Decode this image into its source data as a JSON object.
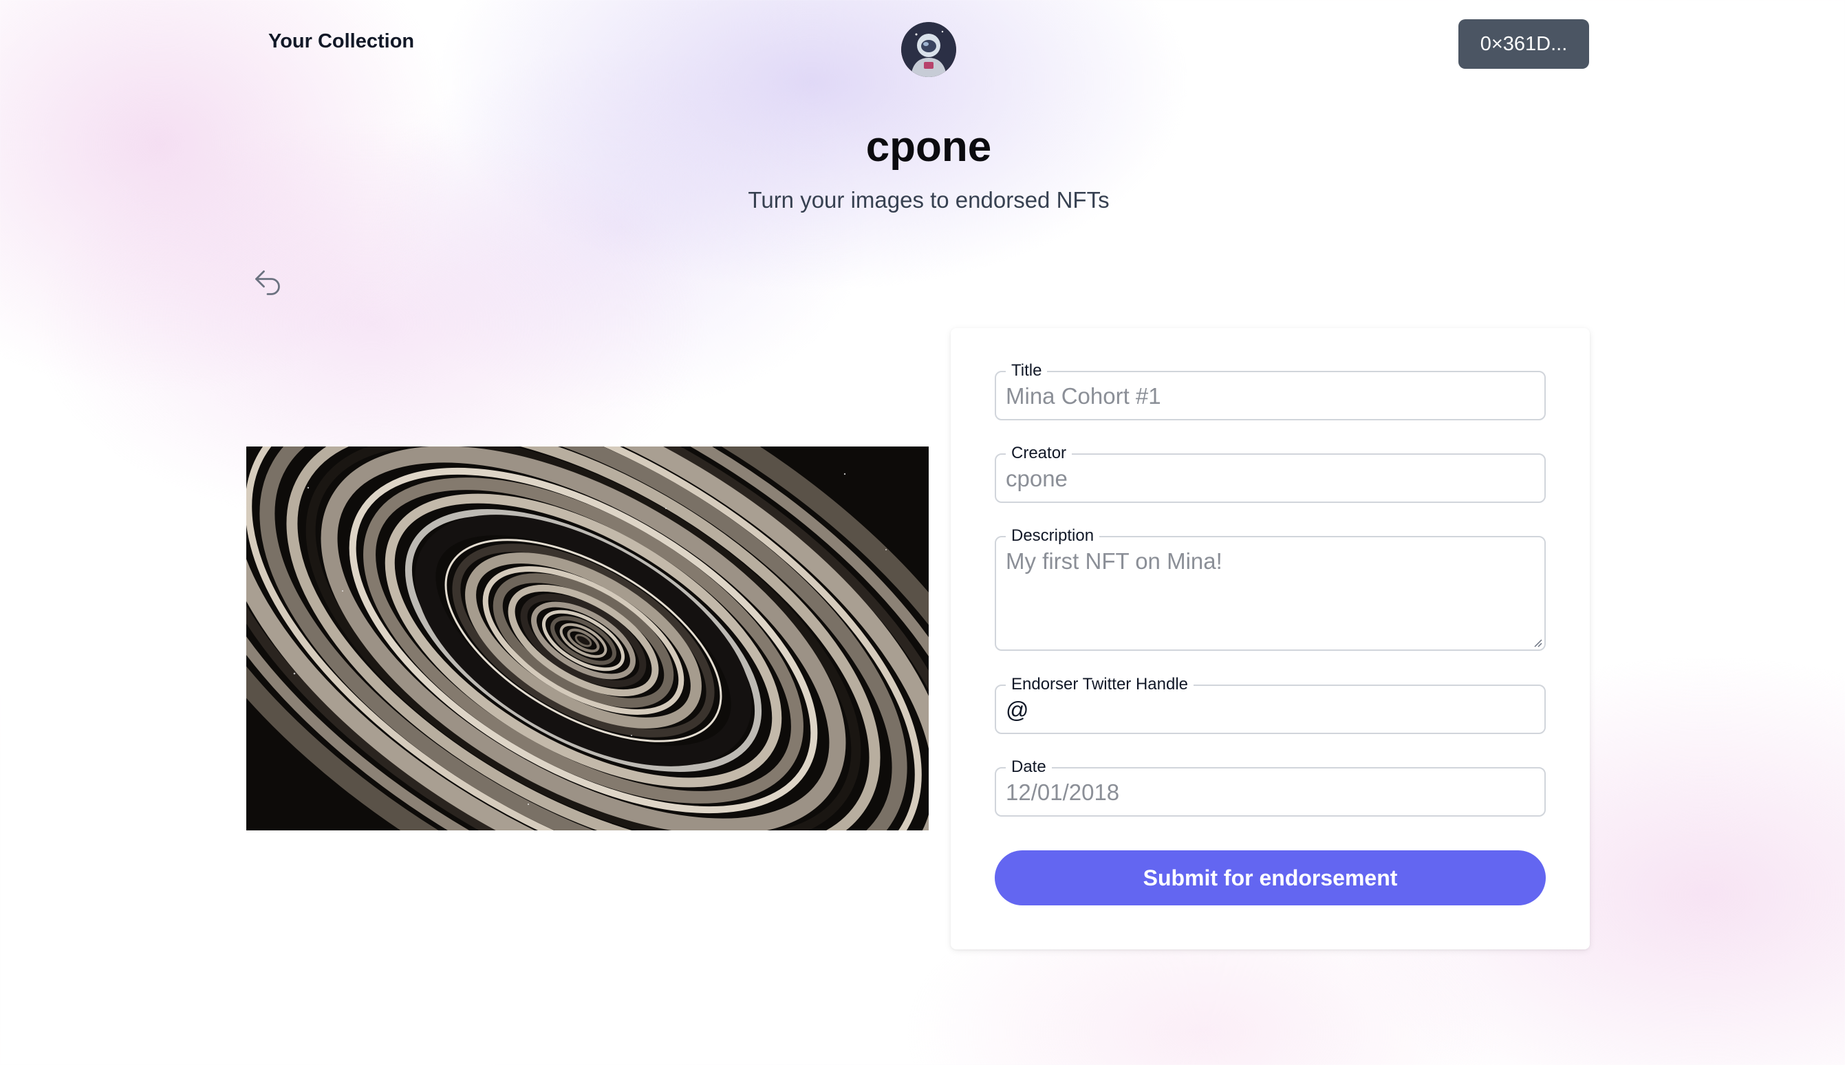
{
  "header": {
    "nav_link": "Your Collection",
    "wallet_address": "0×361D..."
  },
  "hero": {
    "title": "cpone",
    "subtitle": "Turn your images to endorsed NFTs"
  },
  "form": {
    "title": {
      "label": "Title",
      "value": "Mina Cohort #1"
    },
    "creator": {
      "label": "Creator",
      "value": "cpone"
    },
    "description": {
      "label": "Description",
      "value": "My first NFT on Mina!"
    },
    "twitter": {
      "label": "Endorser Twitter Handle",
      "value": "@"
    },
    "date": {
      "label": "Date",
      "value": "12/01/2018"
    },
    "submit_label": "Submit for endorsement"
  },
  "icons": {
    "back": "undo-arrow-icon",
    "avatar": "astronaut-avatar",
    "artwork": "ringed-planet-image"
  },
  "colors": {
    "accent": "#6366f1",
    "wallet_button": "#4b5563"
  }
}
